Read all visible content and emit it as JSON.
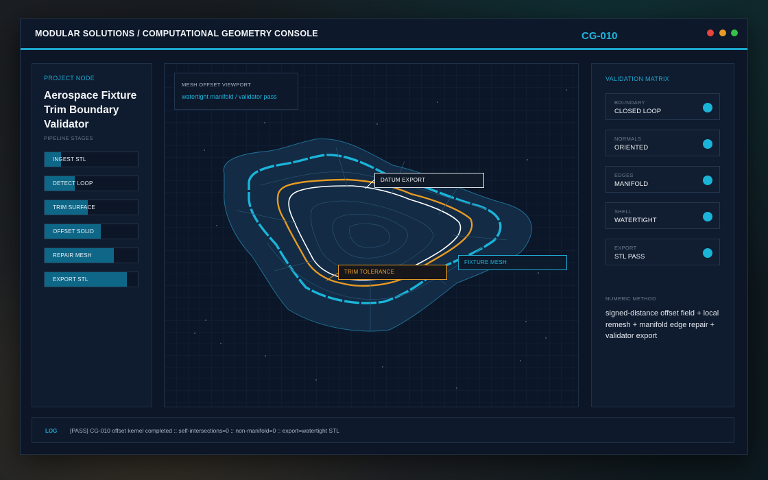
{
  "app": {
    "title": "MODULAR SOLUTIONS / COMPUTATIONAL GEOMETRY CONSOLE",
    "code": "CG-010"
  },
  "window_controls": [
    "close",
    "minimize",
    "maximize"
  ],
  "project": {
    "eyebrow": "PROJECT NODE",
    "title": "Aerospace Fixture Trim Boundary Validator",
    "stages_label": "PIPELINE STAGES",
    "stages": [
      {
        "label": "INGEST STL",
        "progress": 0.18
      },
      {
        "label": "DETECT LOOP",
        "progress": 0.32
      },
      {
        "label": "TRIM SURFACE",
        "progress": 0.46
      },
      {
        "label": "OFFSET SOLID",
        "progress": 0.6
      },
      {
        "label": "REPAIR MESH",
        "progress": 0.74
      },
      {
        "label": "EXPORT STL",
        "progress": 0.88
      }
    ]
  },
  "viewport": {
    "title": "MESH OFFSET VIEWPORT",
    "subtitle": "watertight manifold / validator pass",
    "callouts": {
      "datum": "DATUM EXPORT",
      "trim": "TRIM TOLERANCE",
      "fixture": "FIXTURE MESH"
    }
  },
  "validation": {
    "eyebrow": "VALIDATION MATRIX",
    "checks": [
      {
        "key": "BOUNDARY",
        "value": "CLOSED LOOP"
      },
      {
        "key": "NORMALS",
        "value": "ORIENTED"
      },
      {
        "key": "EDGES",
        "value": "MANIFOLD"
      },
      {
        "key": "SHELL",
        "value": "WATERTIGHT"
      },
      {
        "key": "EXPORT",
        "value": "STL PASS"
      }
    ],
    "method_label": "NUMERIC METHOD",
    "method_text": "signed-distance offset field + local remesh + manifold edge repair + validator export"
  },
  "log": {
    "tag": "LOG",
    "text": "[PASS] CG-010 offset kernel completed :: self-intersections=0 :: non-manifold=0 :: export=watertight STL"
  },
  "colors": {
    "accent": "#1fb4dc",
    "warning": "#e79a22",
    "datum": "#ffffff",
    "close": "#e8453c",
    "minimize": "#e89a28",
    "maximize": "#35c24a"
  }
}
